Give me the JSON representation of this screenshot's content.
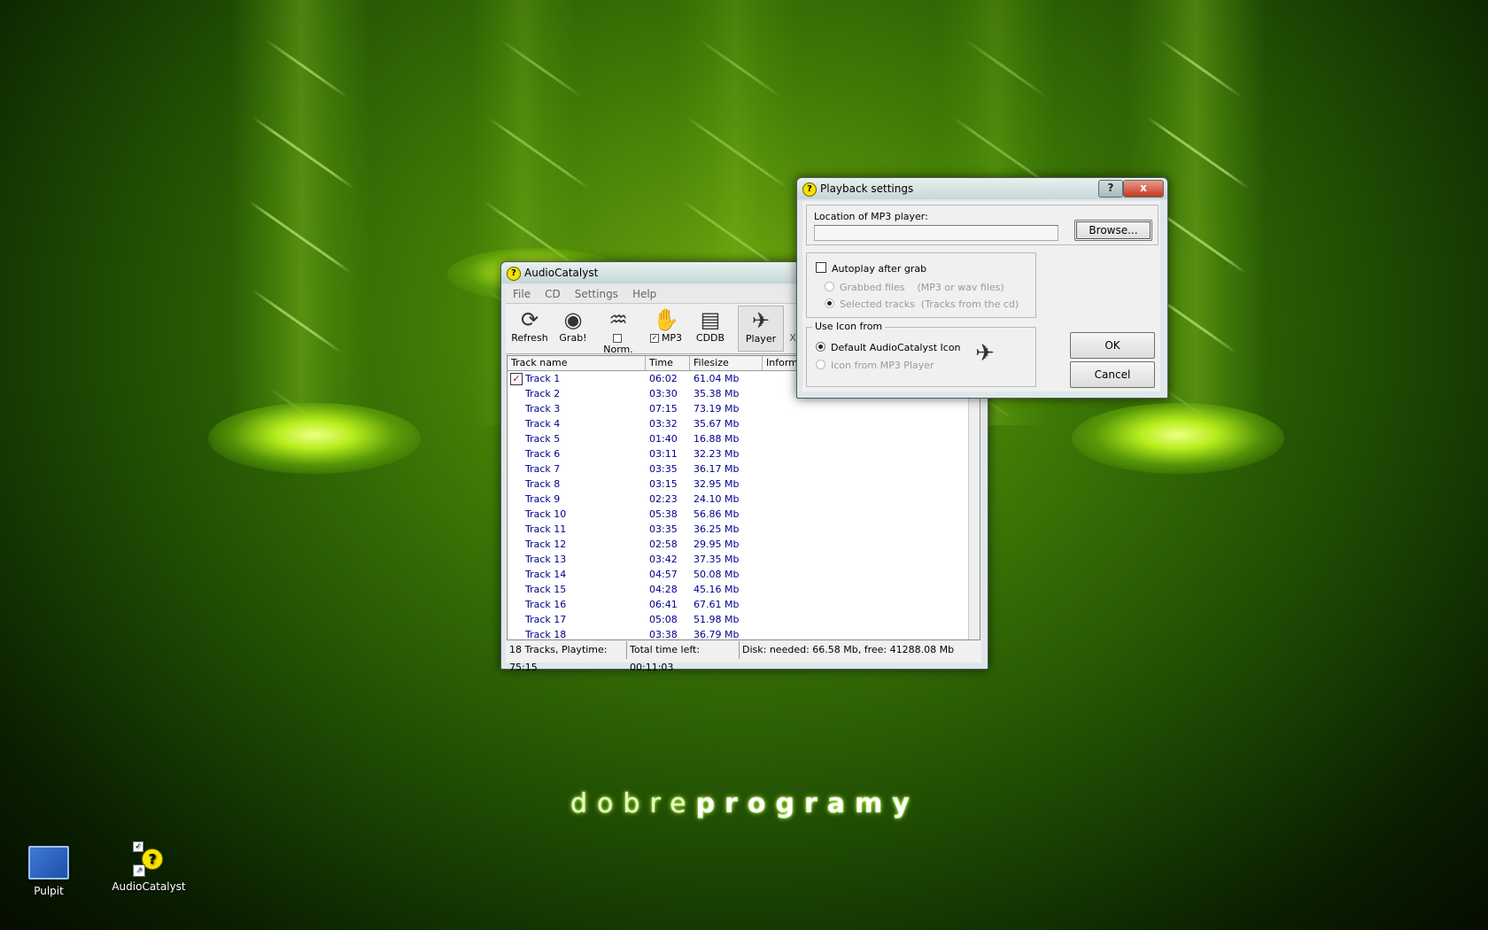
{
  "desktop": {
    "brand_thin": "dobre",
    "brand_bold": "programy",
    "icons": [
      {
        "label": "Pulpit"
      },
      {
        "label": "AudioCatalyst"
      }
    ]
  },
  "main_window": {
    "title": "AudioCatalyst",
    "menu": [
      "File",
      "CD",
      "Settings",
      "Help"
    ],
    "toolbar": {
      "refresh": "Refresh",
      "grab": "Grab!",
      "norm": "Norm.",
      "mp3": "MP3",
      "cddb": "CDDB",
      "player": "Player",
      "overflow": "X"
    },
    "columns": [
      "Track name",
      "Time",
      "Filesize",
      "Informa"
    ],
    "tracks": [
      {
        "name": "Track  1",
        "time": "06:02",
        "size": "61.04 Mb",
        "checked": true
      },
      {
        "name": "Track  2",
        "time": "03:30",
        "size": "35.38 Mb"
      },
      {
        "name": "Track  3",
        "time": "07:15",
        "size": "73.19 Mb"
      },
      {
        "name": "Track  4",
        "time": "03:32",
        "size": "35.67 Mb"
      },
      {
        "name": "Track  5",
        "time": "01:40",
        "size": "16.88 Mb"
      },
      {
        "name": "Track  6",
        "time": "03:11",
        "size": "32.23 Mb"
      },
      {
        "name": "Track  7",
        "time": "03:35",
        "size": "36.17 Mb"
      },
      {
        "name": "Track  8",
        "time": "03:15",
        "size": "32.95 Mb"
      },
      {
        "name": "Track  9",
        "time": "02:23",
        "size": "24.10 Mb"
      },
      {
        "name": "Track 10",
        "time": "05:38",
        "size": "56.86 Mb"
      },
      {
        "name": "Track 11",
        "time": "03:35",
        "size": "36.25 Mb"
      },
      {
        "name": "Track 12",
        "time": "02:58",
        "size": "29.95 Mb"
      },
      {
        "name": "Track 13",
        "time": "03:42",
        "size": "37.35 Mb"
      },
      {
        "name": "Track 14",
        "time": "04:57",
        "size": "50.08 Mb"
      },
      {
        "name": "Track 15",
        "time": "04:28",
        "size": "45.16 Mb"
      },
      {
        "name": "Track 16",
        "time": "06:41",
        "size": "67.61 Mb"
      },
      {
        "name": "Track 17",
        "time": "05:08",
        "size": "51.98 Mb"
      },
      {
        "name": "Track 18",
        "time": "03:38",
        "size": "36.79 Mb"
      }
    ],
    "status": {
      "tracks": "18 Tracks,  Playtime: 75:15",
      "time_left": "Total time left: 00:11:03",
      "disk": "Disk: needed: 66.58 Mb, free: 41288.08 Mb"
    }
  },
  "dialog": {
    "title": "Playback settings",
    "location_label": "Location of MP3 player:",
    "location_value": "",
    "browse": "Browse...",
    "autoplay": "Autoplay after grab",
    "grabbed_files": "Grabbed files",
    "grabbed_hint": "(MP3 or wav files)",
    "selected_tracks": "Selected tracks",
    "selected_hint": "(Tracks from the cd)",
    "icon_group": "Use Icon from",
    "icon_default": "Default  AudioCatalyst Icon",
    "icon_player": "Icon from MP3 Player",
    "ok": "OK",
    "cancel": "Cancel",
    "help_btn": "?",
    "close_btn": "x"
  }
}
